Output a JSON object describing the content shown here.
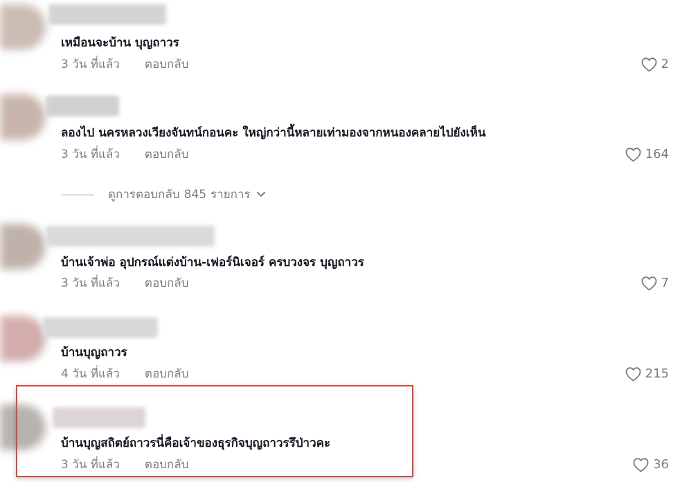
{
  "comments": [
    {
      "text": "เหมือนจะบ้าน บุญถาวร",
      "time": "3 วัน ที่แล้ว",
      "reply": "ตอบกลับ",
      "likes": "2"
    },
    {
      "text": "ลองไป นครหลวงเวียงจันทน์กอนคะ ใหญ่กว่านี้หลายเท่ามองจากหนองคลายไปยังเห็น",
      "time": "3 วัน ที่แล้ว",
      "reply": "ตอบกลับ",
      "likes": "164"
    },
    {
      "text": "บ้านเจ้าพ่อ อุปกรณ์แต่งบ้าน-เฟอร์นิเจอร์ ครบวงจร บุญถาวร",
      "time": "3 วัน ที่แล้ว",
      "reply": "ตอบกลับ",
      "likes": "7"
    },
    {
      "text": "บ้านบุญถาวร",
      "time": "4 วัน ที่แล้ว",
      "reply": "ตอบกลับ",
      "likes": "215"
    },
    {
      "text": "บ้านบุญสถิตย์ถาวรนี่คือเจ้าของธุรกิจบุญถาวรรึป่าวคะ",
      "time": "3 วัน ที่แล้ว",
      "reply": "ตอบกลับ",
      "likes": "36"
    }
  ],
  "view_replies": {
    "prefix": "ดูการตอบกลับ",
    "count": "845",
    "suffix": "รายการ"
  },
  "colors": {
    "text": "#161823",
    "muted": "#7c7c7c",
    "highlight": "#d9473f"
  },
  "icons": {
    "like": "heart-outline-icon",
    "expand": "chevron-down-icon"
  }
}
